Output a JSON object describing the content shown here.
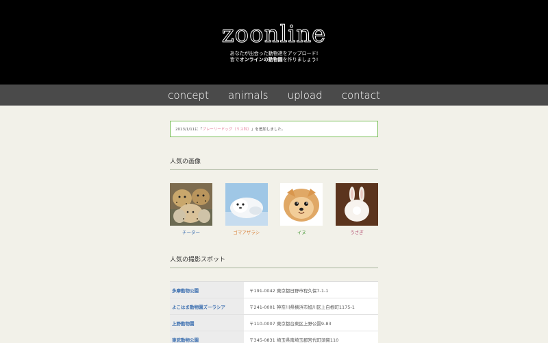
{
  "header": {
    "logo": "zoonline",
    "tagline_1": "あなたが出会った動物達をアップロード!",
    "tagline_2_pre": "皆で",
    "tagline_2_bold": "オンラインの動物園",
    "tagline_2_post": "を作りましょう!"
  },
  "nav": {
    "items": [
      {
        "label": "concept"
      },
      {
        "label": "animals"
      },
      {
        "label": "upload"
      },
      {
        "label": "contact"
      }
    ]
  },
  "notice": {
    "date_text": "2013/1/11に「",
    "link_text": "プレーリードッグ（リス科）",
    "suffix_text": "」を追加しました。"
  },
  "popular_images": {
    "title": "人気の画像",
    "items": [
      {
        "caption": "チーター",
        "caption_color": "#3c6fb0"
      },
      {
        "caption": "ゴマアザラシ",
        "caption_color": "#d9823b"
      },
      {
        "caption": "イヌ",
        "caption_color": "#4a9a3a"
      },
      {
        "caption": "うさぎ",
        "caption_color": "#b0466b"
      }
    ]
  },
  "popular_spots": {
    "title": "人気の撮影スポット",
    "rows": [
      {
        "name": "多摩動物公園",
        "address": "〒191-0042 東京都日野市程久保7-1-1"
      },
      {
        "name": "よこはま動物園ズーラシア",
        "address": "〒241-0001 神奈川県横浜市旭川区上白根町1175-1"
      },
      {
        "name": "上野動物園",
        "address": "〒110-0007 東京都台東区上野公園9-83"
      },
      {
        "name": "東武動物公園",
        "address": "〒345-0831 埼玉県南埼玉郡宮代町須賀110"
      }
    ]
  }
}
